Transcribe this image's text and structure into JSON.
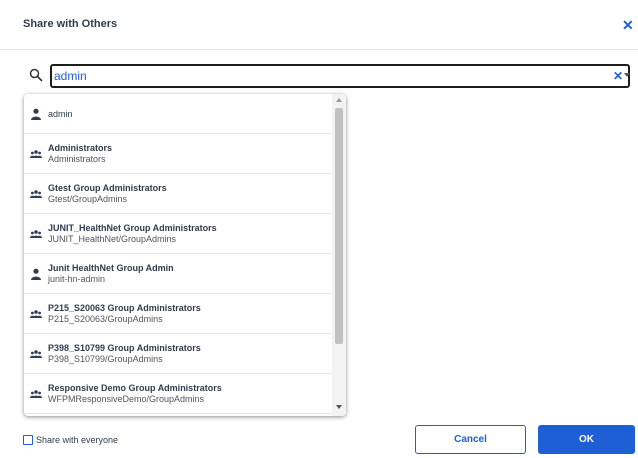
{
  "dialog": {
    "title": "Share with Others",
    "close_icon": "close-icon"
  },
  "search": {
    "value": "admin",
    "search_icon": "search-icon",
    "clear_icon": "clear-icon",
    "dropdown_icon": "chevron-down-icon"
  },
  "results": [
    {
      "icon": "user-icon",
      "name": "admin",
      "sub": ""
    },
    {
      "icon": "group-icon",
      "name": "Administrators",
      "sub": "Administrators"
    },
    {
      "icon": "group-icon",
      "name": "Gtest Group Administrators",
      "sub": "Gtest/GroupAdmins"
    },
    {
      "icon": "group-icon",
      "name": "JUNIT_HealthNet Group Administrators",
      "sub": "JUNIT_HealthNet/GroupAdmins"
    },
    {
      "icon": "user-icon",
      "name": "Junit HealthNet Group Admin",
      "sub": "junit-hn-admin"
    },
    {
      "icon": "group-icon",
      "name": "P215_S20063 Group Administrators",
      "sub": "P215_S20063/GroupAdmins"
    },
    {
      "icon": "group-icon",
      "name": "P398_S10799 Group Administrators",
      "sub": "P398_S10799/GroupAdmins"
    },
    {
      "icon": "group-icon",
      "name": "Responsive Demo Group Administrators",
      "sub": "WFPMResponsiveDemo/GroupAdmins"
    }
  ],
  "footer": {
    "share_everyone_label": "Share with everyone",
    "share_everyone_checked": false,
    "cancel_label": "Cancel",
    "ok_label": "OK"
  },
  "colors": {
    "accent": "#1f5fd6",
    "text": "#2f3c4e"
  }
}
